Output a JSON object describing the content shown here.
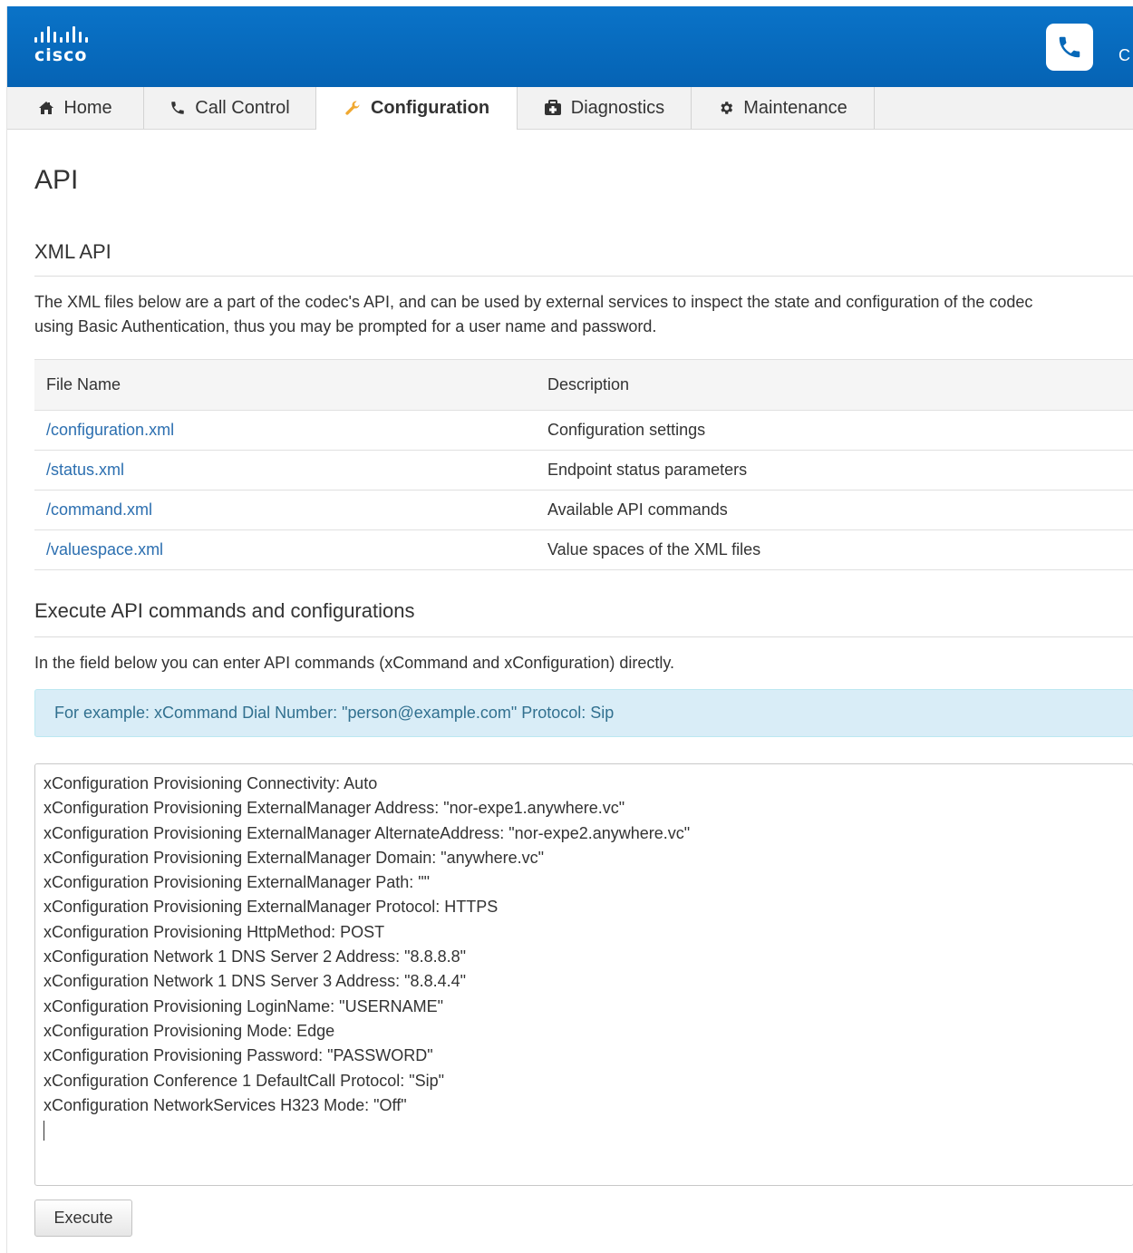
{
  "brand": {
    "logo_text": "cisco",
    "colors": {
      "header": "#0668b8",
      "link": "#2c6fb0",
      "alert_bg": "#d9edf7",
      "alert_text": "#31708f"
    }
  },
  "header": {
    "cut_text": "C",
    "phone_icon": "phone-icon"
  },
  "nav": {
    "tabs": [
      {
        "label": "Home",
        "icon": "home-icon"
      },
      {
        "label": "Call Control",
        "icon": "phone-icon"
      },
      {
        "label": "Configuration",
        "icon": "wrench-icon",
        "active": true
      },
      {
        "label": "Diagnostics",
        "icon": "medkit-icon"
      },
      {
        "label": "Maintenance",
        "icon": "gear-icon"
      }
    ]
  },
  "page": {
    "title": "API",
    "xml_api": {
      "heading": "XML API",
      "description_line1": "The XML files below are a part of the codec's API, and can be used by external services to inspect the state and configuration of the codec",
      "description_line2": "using Basic Authentication, thus you may be prompted for a user name and password.",
      "table": {
        "headers": [
          "File Name",
          "Description"
        ],
        "rows": [
          {
            "file": "/configuration.xml",
            "description": "Configuration settings"
          },
          {
            "file": "/status.xml",
            "description": "Endpoint status parameters"
          },
          {
            "file": "/command.xml",
            "description": "Available API commands"
          },
          {
            "file": "/valuespace.xml",
            "description": "Value spaces of the XML files"
          }
        ]
      }
    },
    "execute": {
      "heading": "Execute API commands and configurations",
      "description": "In the field below you can enter API commands (xCommand and xConfiguration) directly.",
      "example": "For example: xCommand Dial Number: \"person@example.com\" Protocol: Sip",
      "commands": [
        "xConfiguration Provisioning Connectivity: Auto",
        "xConfiguration Provisioning ExternalManager Address: \"nor-expe1.anywhere.vc\"",
        "xConfiguration Provisioning ExternalManager AlternateAddress: \"nor-expe2.anywhere.vc\"",
        "xConfiguration Provisioning ExternalManager Domain: \"anywhere.vc\"",
        "xConfiguration Provisioning ExternalManager Path: \"\"",
        "xConfiguration Provisioning ExternalManager Protocol: HTTPS",
        "xConfiguration Provisioning HttpMethod: POST",
        "xConfiguration Network 1 DNS Server 2 Address: \"8.8.8.8\"",
        "xConfiguration Network 1 DNS Server 3 Address: \"8.8.4.4\"",
        "xConfiguration Provisioning LoginName: \"USERNAME\"",
        "xConfiguration Provisioning Mode: Edge",
        "xConfiguration Provisioning Password: \"PASSWORD\"",
        "xConfiguration Conference 1 DefaultCall Protocol: \"Sip\"",
        "xConfiguration NetworkServices H323 Mode: \"Off\""
      ],
      "execute_label": "Execute"
    }
  }
}
